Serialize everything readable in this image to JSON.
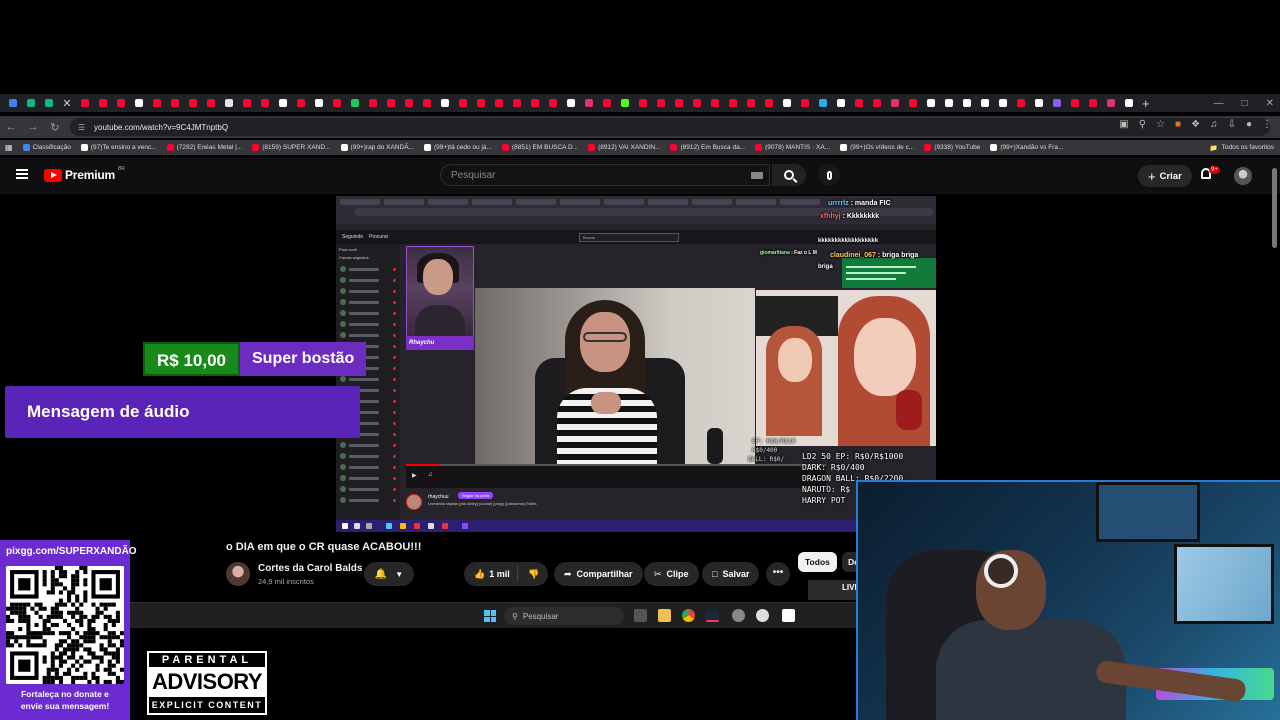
{
  "browser": {
    "tabs": [
      {
        "color": "#3b82f6"
      },
      {
        "color": "#10b981"
      },
      {
        "color": "#10b981"
      },
      {
        "color": "#ffffff",
        "close": true
      },
      {
        "color": "#ff0033"
      },
      {
        "color": "#ff0033"
      },
      {
        "color": "#ff0033"
      },
      {
        "color": "#ffffff"
      },
      {
        "color": "#ff0033"
      },
      {
        "color": "#ff0033"
      },
      {
        "color": "#ff0033"
      },
      {
        "color": "#ff0033"
      },
      {
        "color": "#e5e5e5"
      },
      {
        "color": "#ff0033"
      },
      {
        "color": "#ff0033"
      },
      {
        "color": "#ffffff"
      },
      {
        "color": "#ff0033"
      },
      {
        "color": "#ffffff"
      },
      {
        "color": "#ff0033"
      },
      {
        "color": "#22c55e"
      },
      {
        "color": "#ff0033"
      },
      {
        "color": "#ff0033"
      },
      {
        "color": "#ff0033"
      },
      {
        "color": "#ff0033"
      },
      {
        "color": "#ffffff"
      },
      {
        "color": "#ff0033"
      },
      {
        "color": "#ff0033"
      },
      {
        "color": "#ff0033"
      },
      {
        "color": "#ff0033"
      },
      {
        "color": "#ff0033"
      },
      {
        "color": "#ff0033"
      },
      {
        "color": "#ffffff"
      },
      {
        "color": "#e1306c"
      },
      {
        "color": "#ff0033"
      },
      {
        "color": "#53fc18"
      },
      {
        "color": "#ff0033"
      },
      {
        "color": "#ff0033"
      },
      {
        "color": "#ff0033"
      },
      {
        "color": "#ff0033"
      },
      {
        "color": "#ff0033"
      },
      {
        "color": "#ff0033"
      },
      {
        "color": "#ff0033"
      },
      {
        "color": "#ff0033"
      },
      {
        "color": "#ffffff"
      },
      {
        "color": "#ff0033"
      },
      {
        "color": "#2aabee"
      },
      {
        "color": "#ffffff"
      },
      {
        "color": "#ff0033"
      },
      {
        "color": "#ff0033"
      },
      {
        "color": "#e1306c"
      },
      {
        "color": "#ff0033"
      },
      {
        "color": "#ffffff"
      },
      {
        "color": "#ffffff"
      },
      {
        "color": "#ffffff"
      },
      {
        "color": "#ffffff"
      },
      {
        "color": "#ffffff"
      },
      {
        "color": "#ff0033"
      },
      {
        "color": "#ffffff"
      },
      {
        "color": "#8b5cf6"
      },
      {
        "color": "#ff0033"
      },
      {
        "color": "#ff0033"
      },
      {
        "color": "#e1306c"
      },
      {
        "color": "#ffffff"
      }
    ],
    "new_tab": "+",
    "url": "youtube.com/watch?v=9C4JMTnptbQ",
    "bookmarks": [
      {
        "label": "Classificação",
        "color": "#4285f4"
      },
      {
        "label": "(97)Te ensino a venc...",
        "color": "#ffffff"
      },
      {
        "label": "(7292) Enéas Metal |...",
        "color": "#ff0033"
      },
      {
        "label": "(8159) SUPER XAND...",
        "color": "#ff0033"
      },
      {
        "label": "(99+)rap do XANDÃ...",
        "color": "#ffffff"
      },
      {
        "label": "(99+)tá cedo ou já...",
        "color": "#ffffff"
      },
      {
        "label": "(8851) EM BUSCA D...",
        "color": "#ff0033"
      },
      {
        "label": "(8912) VAI XANDIN...",
        "color": "#ff0033"
      },
      {
        "label": "(8912) Em Busca da...",
        "color": "#ff0033"
      },
      {
        "label": "(9078) MANTIS · XA...",
        "color": "#ff0033"
      },
      {
        "label": "(99+)Os vídeos de c...",
        "color": "#ffffff"
      },
      {
        "label": "(9338) YouTube",
        "color": "#ff0033"
      },
      {
        "label": "(99+)Xandão vs Fra...",
        "color": "#ffffff"
      }
    ],
    "all_bookmarks": "Todos os favoritos"
  },
  "youtube": {
    "logo_text": "Premium",
    "logo_region": "BR",
    "search_placeholder": "Pesquisar",
    "create_label": "Criar",
    "notifications": "9+",
    "video_title": "o DIA em que o CR quase ACABOU!!!",
    "channel_name": "Cortes da Carol Balds",
    "subscribers": "24,9 mil inscritos",
    "likes": "1 mil",
    "share": "Compartilhar",
    "clip": "Clipe",
    "save": "Salvar",
    "more": "•••",
    "chip_all": "Todos",
    "chip_second": "De",
    "live_label": "LIVE"
  },
  "embedded": {
    "twitch_follow_tab": "Seguindo",
    "twitch_browse_tab": "Procurar",
    "twitch_search": "Buscar",
    "sidebar_header": "Para você",
    "sidebar_sub": "Canais seguidos",
    "cam_tag": "Rhaychu",
    "streamer_name": "rhaychuu",
    "follow_btn": "Seguir na porta",
    "stream_title": "Livezinha rápida (pós lobby) (social) (prog) (patrocínio) Estria",
    "chat": [
      {
        "user": "urrrrlz",
        "text": ": manda FIC"
      },
      {
        "user": "xfhhyj",
        "text": ": Kkkkkkkk"
      },
      {
        "user": "",
        "text": "kkkkkkkkkkkkkkkkkk"
      },
      {
        "user": "giomaritiana",
        "text": ": Faz o L M"
      },
      {
        "user": "claudinei_067",
        "text": ": briga briga"
      },
      {
        "user": "",
        "text": "briga"
      }
    ],
    "stats": [
      "LD2 50 EP: R$0/R$1000",
      "DARK: R$0/400",
      "DRAGON BALL: R$0/2200",
      "NARUTO: R$",
      "HARRY POT"
    ],
    "small_stats": [
      "EP: R$0/R$10",
      "R$0/400",
      "BALL: R$0/"
    ]
  },
  "taskbar": {
    "search_label": "Pesquisar"
  },
  "overlays": {
    "donation_amount": "R$ 10,00",
    "donation_message": "Super bostão",
    "audio_message": "Mensagem de áudio",
    "pix_url": "pixgg.com/SUPERXANDÃO",
    "pix_cta_line1": "Fortaleça no donate e",
    "pix_cta_line2": "envie sua mensagem!",
    "advisory_top": "PARENTAL",
    "advisory_main": "ADVISORY",
    "advisory_bottom": "EXPLICIT CONTENT"
  }
}
